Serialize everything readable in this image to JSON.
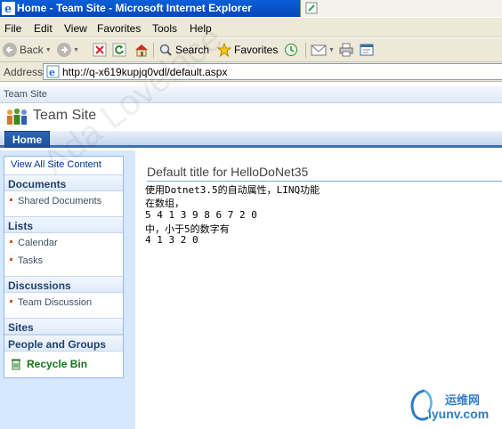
{
  "window": {
    "title": "Home - Team Site - Microsoft Internet Explorer"
  },
  "menu": [
    "File",
    "Edit",
    "View",
    "Favorites",
    "Tools",
    "Help"
  ],
  "toolbar": {
    "back_label": "Back",
    "search_label": "Search",
    "favorites_label": "Favorites"
  },
  "address": {
    "label": "Address",
    "url": "http://q-x619kupjq0vdl/default.aspx"
  },
  "sharepoint": {
    "breadcrumb": "Team Site",
    "site_title": "Team Site",
    "tabs": [
      "Home"
    ],
    "quick_launch": {
      "view_all": "View All Site Content",
      "sections": [
        {
          "title": "Documents",
          "items": [
            "Shared Documents"
          ]
        },
        {
          "title": "Lists",
          "items": [
            "Calendar",
            "Tasks"
          ]
        },
        {
          "title": "Discussions",
          "items": [
            "Team Discussion"
          ]
        },
        {
          "title": "Sites",
          "items": []
        },
        {
          "title": "People and Groups",
          "items": []
        }
      ],
      "recycle_bin": "Recycle Bin"
    },
    "webpart": {
      "title": "Default title for HelloDoNet35",
      "lines": [
        "使用Dotnet3.5的自动属性，LINQ功能",
        "在数组，",
        "5 4 1 3 9 8 6 7 2 0",
        "中，小于5的数字有",
        "4 1 3 2 0"
      ]
    }
  },
  "overlay": {
    "watermark": "Ada Lovelace",
    "brand_cn": "运维网",
    "brand_en": "iyunv.com"
  },
  "colors": {
    "title_bar": "#0a5fd8",
    "chrome": "#ece9d8",
    "sp_nav_active": "#2b66b6",
    "quick_launch_bg": "#d6e8ff",
    "recycle_green": "#12751a"
  }
}
